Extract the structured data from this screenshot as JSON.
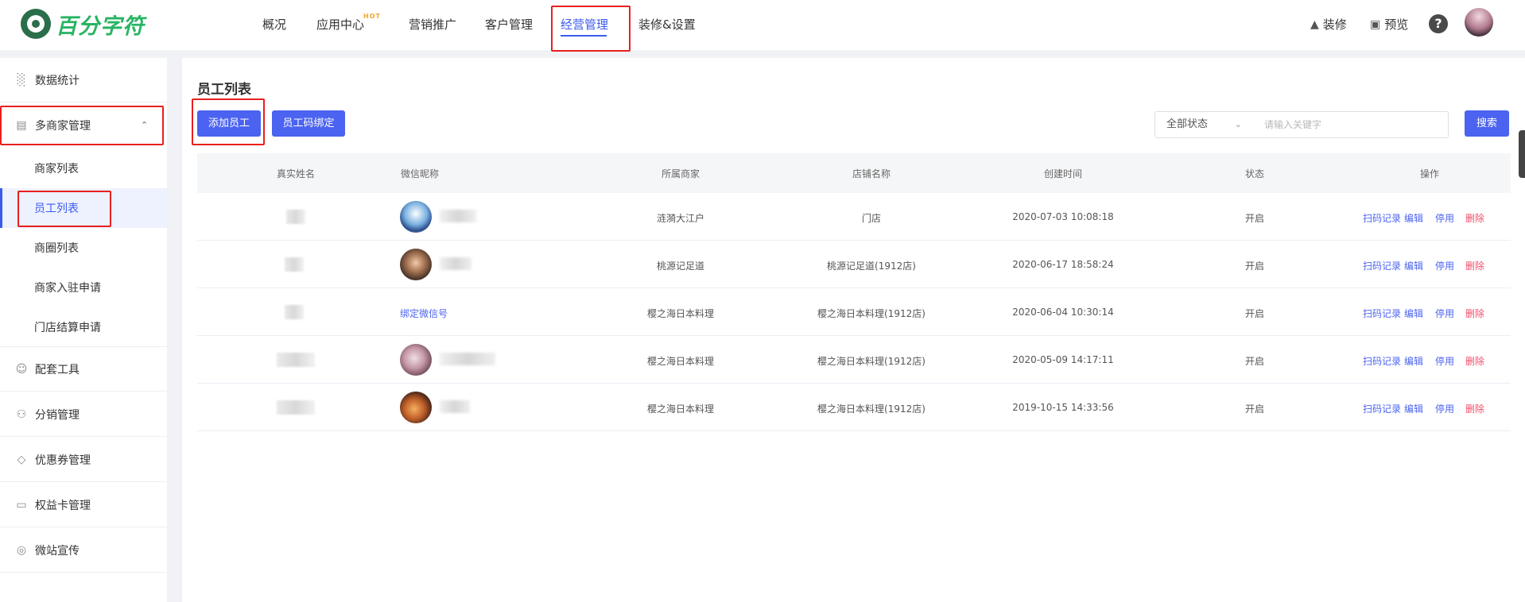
{
  "brand": {
    "name": "百分字符"
  },
  "topnav": {
    "items": [
      "概况",
      "应用中心",
      "营销推广",
      "客户管理",
      "经营管理",
      "装修&设置"
    ],
    "hot_tag": "HOT",
    "right": {
      "decorate": "装修",
      "preview": "预览",
      "help": "?"
    }
  },
  "sidebar": {
    "items": [
      {
        "label": "数据统计",
        "icon": "bar-chart-icon"
      },
      {
        "label": "多商家管理",
        "icon": "store-icon"
      },
      {
        "label": "配套工具",
        "icon": "smile-icon"
      },
      {
        "label": "分销管理",
        "icon": "users-icon"
      },
      {
        "label": "优惠券管理",
        "icon": "coupon-icon"
      },
      {
        "label": "权益卡管理",
        "icon": "card-icon"
      },
      {
        "label": "微站宣传",
        "icon": "globe-icon"
      }
    ],
    "subitems": [
      "商家列表",
      "员工列表",
      "商圈列表",
      "商家入驻申请",
      "门店结算申请"
    ]
  },
  "main": {
    "title": "员工列表",
    "add_button": "添加员工",
    "bind_button": "员工码绑定",
    "status_select": "全部状态",
    "search_placeholder": "请输入关键字",
    "search_button": "搜索"
  },
  "table": {
    "headers": [
      "真实姓名",
      "微信昵称",
      "所属商家",
      "店铺名称",
      "创建时间",
      "状态",
      "操作"
    ],
    "actions": [
      "扫码记录",
      "编辑",
      "停用",
      "删除"
    ],
    "rows": [
      {
        "merchant": "涟漪大江户",
        "store": "门店",
        "created": "2020-07-03 10:08:18",
        "status": "开启",
        "nickname": ""
      },
      {
        "merchant": "桃源记足道",
        "store": "桃源记足道(1912店)",
        "created": "2020-06-17 18:58:24",
        "status": "开启",
        "nickname": ""
      },
      {
        "merchant": "樱之海日本料理",
        "store": "樱之海日本料理(1912店)",
        "created": "2020-06-04 10:30:14",
        "status": "开启",
        "nickname": "绑定微信号"
      },
      {
        "merchant": "樱之海日本料理",
        "store": "樱之海日本料理(1912店)",
        "created": "2020-05-09 14:17:11",
        "status": "开启",
        "nickname": ""
      },
      {
        "merchant": "樱之海日本料理",
        "store": "樱之海日本料理(1912店)",
        "created": "2019-10-15 14:33:56",
        "status": "开启",
        "nickname": ""
      }
    ]
  },
  "colors": {
    "accent": "#4b63f0",
    "brand_green": "#28b463",
    "danger": "#f0506a",
    "highlight_box": "#e8201f"
  }
}
